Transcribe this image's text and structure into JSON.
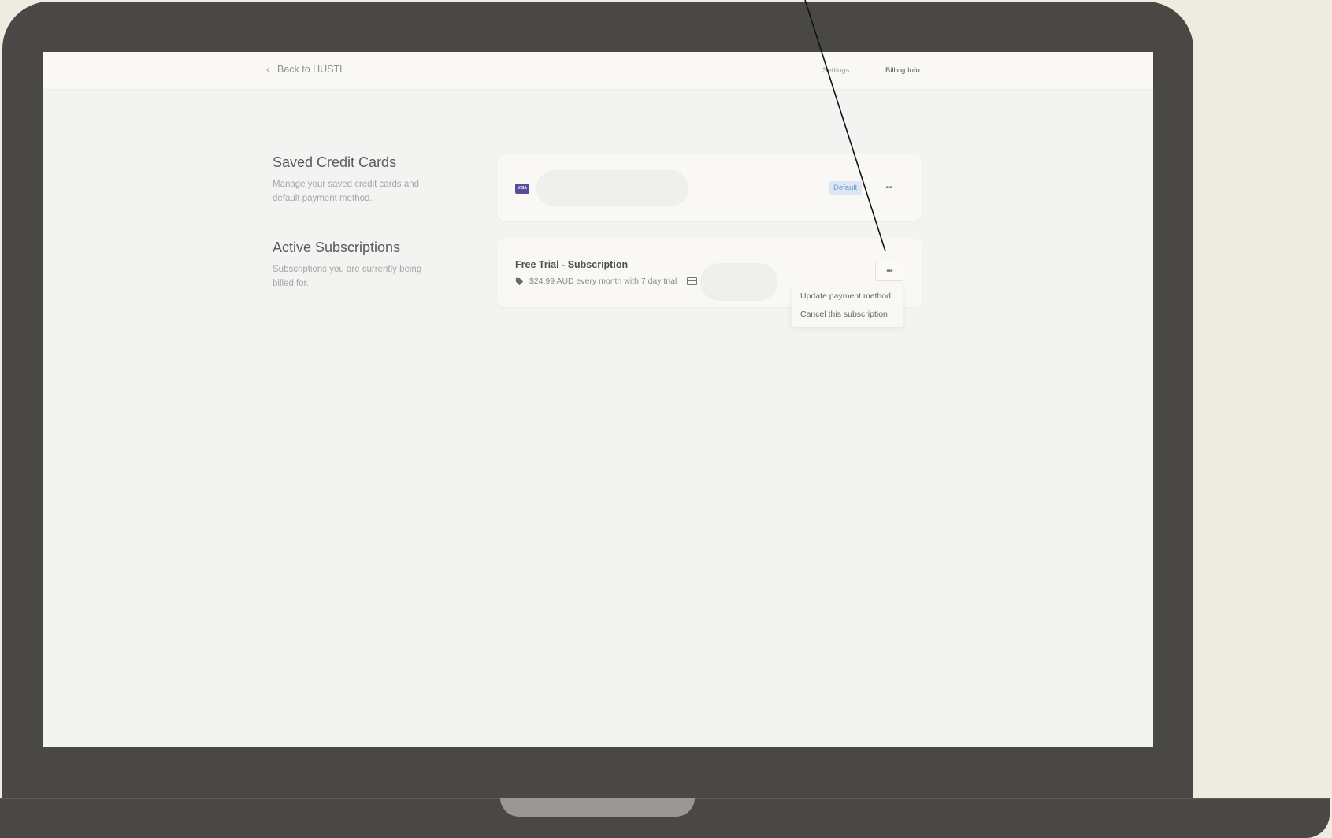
{
  "topbar": {
    "back_label": "Back to HUSTL.",
    "nav": [
      {
        "label": "Settings"
      },
      {
        "label": "Billing Info"
      }
    ]
  },
  "saved_cards": {
    "title": "Saved Credit Cards",
    "description": "Manage your saved credit cards and default payment method.",
    "card": {
      "brand": "VISA",
      "default_badge": "Default",
      "more_label": "•••"
    }
  },
  "subscriptions": {
    "title": "Active Subscriptions",
    "description": "Subscriptions you are currently being billed for.",
    "item": {
      "name": "Free Trial - Subscription",
      "price_text": "$24.99 AUD every month with 7 day trial",
      "more_label": "•••"
    },
    "menu": [
      {
        "label": "Update payment method"
      },
      {
        "label": "Cancel this subscription"
      }
    ]
  },
  "colors": {
    "accent_visa": "#5a4c96",
    "badge_bg": "#dde7f3",
    "badge_text": "#6a9ad0",
    "device_frame": "#4a4844",
    "backdrop": "#eeebe0"
  }
}
